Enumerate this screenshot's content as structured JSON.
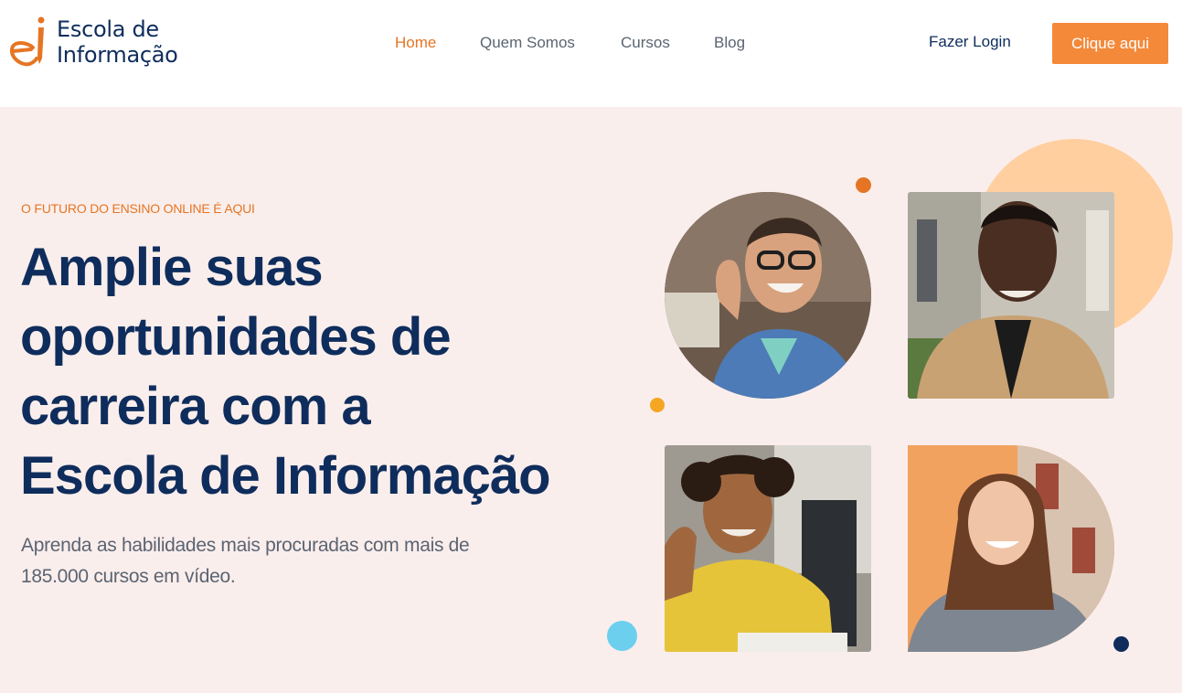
{
  "brand": {
    "line1": "Escola de",
    "line2": "Informação",
    "colors": {
      "navy": "#0f2d5c",
      "orange": "#e57524"
    }
  },
  "nav": {
    "items": [
      "Home",
      "Quem Somos",
      "Cursos",
      "Blog"
    ],
    "active": "Home"
  },
  "header_actions": {
    "login_label": "Fazer Login",
    "cta_label": "Clique aqui"
  },
  "hero": {
    "eyebrow": "O FUTURO DO ENSINO ONLINE É AQUI",
    "headline_lines": [
      "Amplie suas",
      "oportunidades de",
      "carreira com a"
    ],
    "headline_bold": "Escola de Informação",
    "subtitle": "Aprenda as habilidades mais procuradas com mais de 185.000 cursos em vídeo.",
    "background": "#faeeec"
  },
  "colors": {
    "accent": "#f4893a",
    "peach_circle": "#ffcf9f",
    "dot_orange": "#e57524",
    "dot_yellow": "#f5a623",
    "dot_blue": "#6ccfee",
    "dot_navy": "#0f2d5c"
  },
  "photos": [
    {
      "name": "man-with-glasses-photo"
    },
    {
      "name": "man-in-coat-photo"
    },
    {
      "name": "man-in-yellow-shirt-photo"
    },
    {
      "name": "woman-smiling-photo"
    }
  ]
}
